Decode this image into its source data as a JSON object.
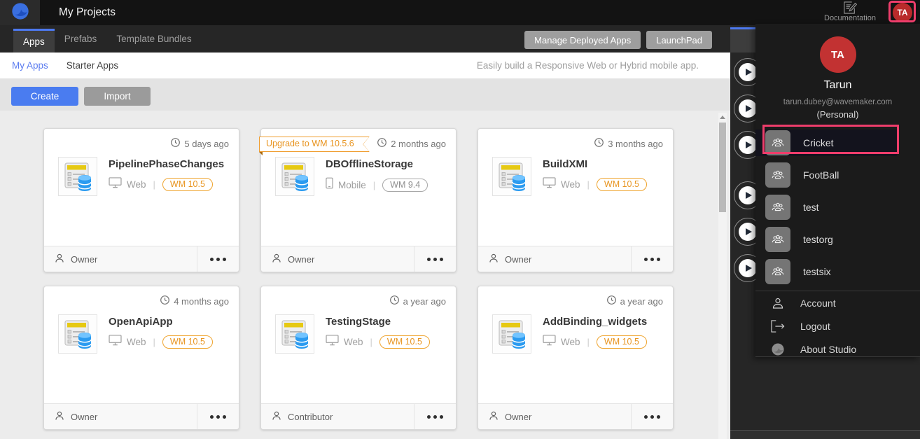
{
  "header": {
    "title": "My Projects",
    "documentation_label": "Documentation",
    "avatar_initials": "TA"
  },
  "tabbar": {
    "tabs": [
      {
        "label": "Apps",
        "active": true
      },
      {
        "label": "Prefabs",
        "active": false
      },
      {
        "label": "Template Bundles",
        "active": false
      }
    ],
    "manage_deployed_apps_label": "Manage Deployed Apps",
    "launchpad_label": "LaunchPad"
  },
  "subnav": {
    "my_apps_label": "My Apps",
    "starter_apps_label": "Starter Apps",
    "active": "My Apps",
    "tagline": "Easily build a Responsive Web or Hybrid mobile app."
  },
  "toolbar": {
    "create_label": "Create",
    "import_label": "Import"
  },
  "projects": [
    {
      "name": "PipelinePhaseChanges",
      "age": "5 days ago",
      "platform": "Web",
      "version": "WM 10.5",
      "version_style": "orange",
      "role": "Owner"
    },
    {
      "name": "DBOfflineStorage",
      "age": "2 months ago",
      "platform": "Mobile",
      "version": "WM 9.4",
      "version_style": "gray",
      "role": "Owner",
      "upgrade_banner": "Upgrade to WM 10.5.6"
    },
    {
      "name": "BuildXMI",
      "age": "3 months ago",
      "platform": "Web",
      "version": "WM 10.5",
      "version_style": "orange",
      "role": "Owner"
    },
    {
      "name": "OpenApiApp",
      "age": "4 months ago",
      "platform": "Web",
      "version": "WM 10.5",
      "version_style": "orange",
      "role": "Owner"
    },
    {
      "name": "TestingStage",
      "age": "a year ago",
      "platform": "Web",
      "version": "WM 10.5",
      "version_style": "orange",
      "role": "Contributor"
    },
    {
      "name": "AddBinding_widgets",
      "age": "a year ago",
      "platform": "Web",
      "version": "WM 10.5",
      "version_style": "orange",
      "role": "Owner"
    }
  ],
  "user_menu": {
    "initials": "TA",
    "name": "Tarun",
    "email": "tarun.dubey@wavemaker.com",
    "scope": "(Personal)",
    "orgs": [
      {
        "label": "Cricket",
        "highlighted": true
      },
      {
        "label": "FootBall",
        "highlighted": false
      },
      {
        "label": "test",
        "highlighted": false
      },
      {
        "label": "testorg",
        "highlighted": false
      },
      {
        "label": "testsix",
        "highlighted": false
      }
    ],
    "actions": [
      {
        "label": "Account",
        "icon": "user-icon"
      },
      {
        "label": "Logout",
        "icon": "logout-icon"
      },
      {
        "label": "About Studio",
        "icon": "wavemaker-icon"
      }
    ]
  },
  "video_strip": {
    "play_button_count": 6
  },
  "colors": {
    "accent_blue": "#4a7cf0",
    "highlight_pink": "#ee3d6b",
    "avatar_red": "#c23232",
    "badge_orange": "#efa42e",
    "header_bg": "#131313",
    "menu_bg": "#1b1b1b"
  }
}
